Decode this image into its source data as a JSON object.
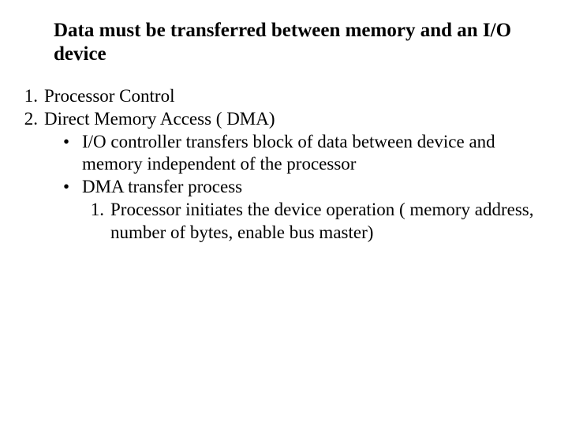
{
  "title": "Data must be transferred between memory and an I/O device",
  "list": {
    "item1": {
      "marker": "1.",
      "text": "Processor Control"
    },
    "item2": {
      "marker": "2.",
      "text": "Direct Memory Access ( DMA)"
    },
    "bullet1": {
      "marker": "•",
      "text": "I/O controller transfers block of data between device and memory independent of the processor"
    },
    "bullet2": {
      "marker": "•",
      "text": "DMA transfer process"
    },
    "sub1": {
      "marker": "1.",
      "text": "Processor initiates the device operation ( memory address, number of bytes, enable bus master)"
    }
  }
}
